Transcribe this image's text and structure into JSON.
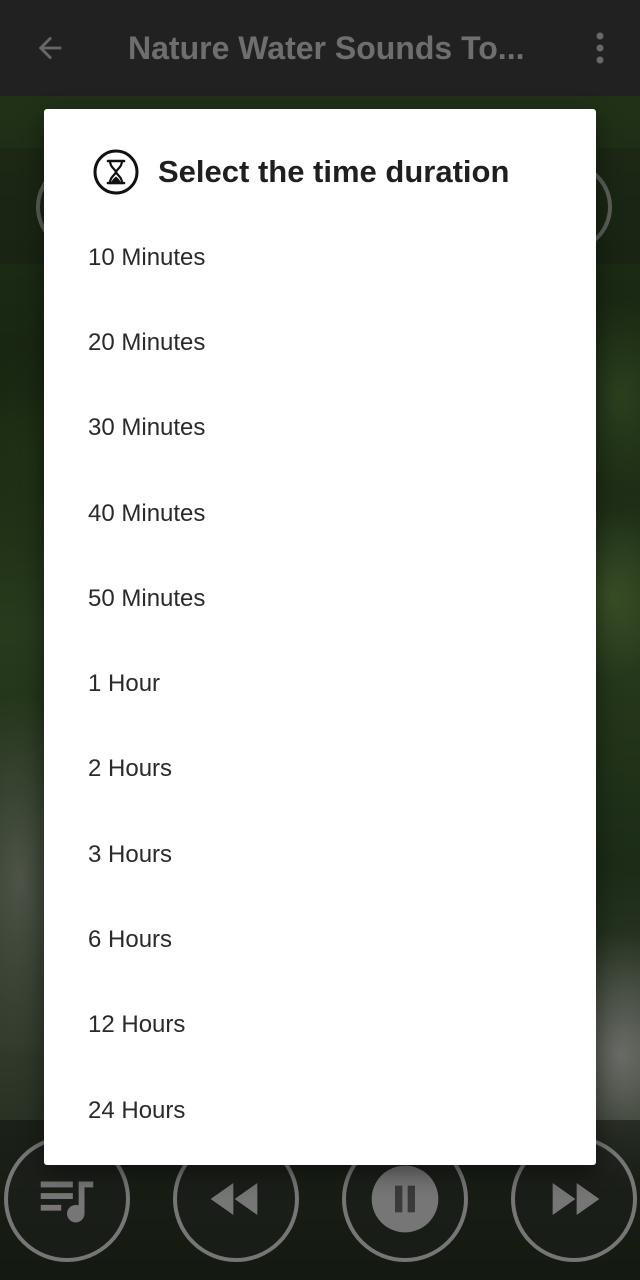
{
  "app_bar": {
    "title": "Nature Water Sounds To...",
    "back_icon": "arrow-left-icon",
    "menu_icon": "more-vert-icon"
  },
  "player_controls": {
    "playlist_icon": "playlist-icon",
    "rewind_icon": "rewind-icon",
    "pause_icon": "pause-icon",
    "forward_icon": "fast-forward-icon"
  },
  "dialog": {
    "title": "Select the time duration",
    "icon": "hourglass-icon",
    "options": [
      "10 Minutes",
      "20 Minutes",
      "30 Minutes",
      "40 Minutes",
      "50 Minutes",
      "1 Hour",
      "2 Hours",
      "3 Hours",
      "6 Hours",
      "12 Hours",
      "24 Hours"
    ]
  },
  "colors": {
    "app_bar": "#3d3d3d",
    "dialog_bg": "#ffffff",
    "text": "#2a2a2a"
  }
}
